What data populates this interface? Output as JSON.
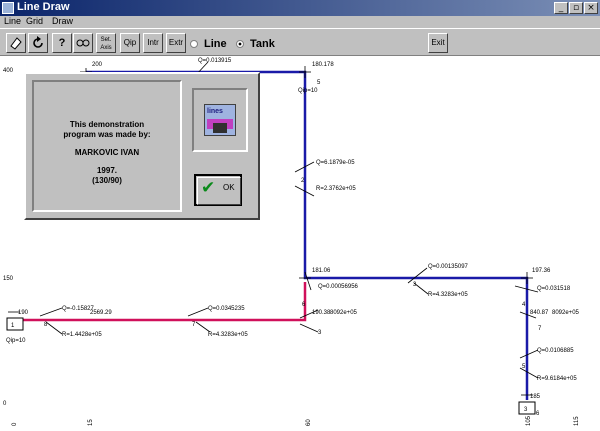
{
  "window": {
    "title": "Line Draw",
    "controls": [
      "_",
      "▫",
      "×"
    ]
  },
  "menu": [
    "Line",
    "Grid",
    "Draw"
  ],
  "toolbar": {
    "buttons": [
      "",
      "",
      "?",
      "Set. Axis",
      "Qip",
      "Intr",
      "Extr"
    ],
    "radio_line": "Line",
    "radio_tank": "Tank",
    "exit": "Exit"
  },
  "dialog": {
    "line1": "This demonstration",
    "line2": "program was made by:",
    "author": "MARKOVIC IVAN",
    "year": "1997.",
    "code": "(130/90)",
    "logo_text": "lines",
    "ok_label": "OK"
  },
  "axis": {
    "y_ticks": [
      "400",
      "150",
      "0"
    ],
    "x_ticks": [
      "0",
      "15",
      "60",
      "105",
      "115"
    ]
  },
  "colors": {
    "blue_line": "#1a1aa8",
    "red_line": "#d0105a",
    "title_bar": "#0a246a"
  },
  "canvas_labels": [
    "200",
    "Q=0.013915",
    "180.178",
    "5",
    "Qip=10",
    "Q=6.1879e-05",
    "2",
    "R=2.3762e+05",
    "181.06",
    "Q=0.00056956",
    "6",
    "190.38",
    "8092e+05",
    "Q=0.00135097",
    "3",
    "R=4.3283e+05",
    "197.36",
    "Q=0.031518",
    "4",
    "840.87",
    "8092e+05",
    "7",
    "Q=0.0106885",
    "5",
    "R=9.6184e+05",
    "185",
    "6",
    "190",
    "Q=-0.15827",
    "2569.29",
    "8",
    "Qip=10",
    "R=1.4428e+05",
    "Q=0.0345235",
    "7",
    "R=4.3283e+05",
    "3",
    "1",
    "3"
  ]
}
